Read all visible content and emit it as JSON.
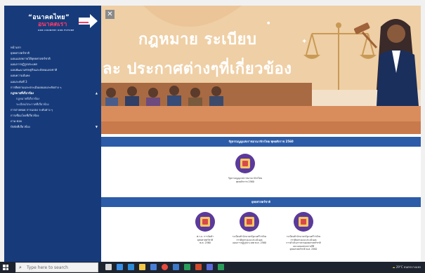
{
  "sidebar": {
    "logo_line1": "“อนาคตไทย”",
    "logo_line2": "อนาคตเรา",
    "logo_tagline": "OUR COUNTRY OUR FUTURE",
    "items": [
      {
        "label": "หน้าแรก",
        "sub": false,
        "caret": ""
      },
      {
        "label": "ยุทธศาสตร์ชาติ",
        "sub": false,
        "caret": ""
      },
      {
        "label": "แผนแม่บทภายใต้ยุทธศาสตร์ชาติ",
        "sub": false,
        "caret": ""
      },
      {
        "label": "แผนการปฏิรูปประเทศ",
        "sub": false,
        "caret": ""
      },
      {
        "label": "แผนพัฒนาเศรษฐกิจและสังคมแห่งชาติ",
        "sub": false,
        "caret": ""
      },
      {
        "label": "แผนความมั่นคง",
        "sub": false,
        "caret": ""
      },
      {
        "label": "แผนระดับที่ 3",
        "sub": false,
        "caret": ""
      },
      {
        "label": "การติดตามและประเมินผลแผนระดับต่าง ๆ",
        "sub": false,
        "caret": ""
      },
      {
        "label": "กฎหมายที่เกี่ยวข้อง",
        "sub": false,
        "caret": "▲"
      },
      {
        "label": "กฎหมายที่เกี่ยวข้อง",
        "sub": true,
        "caret": ""
      },
      {
        "label": "ระเบียบ/ประกาศที่เกี่ยวข้อง",
        "sub": true,
        "caret": ""
      },
      {
        "label": "การถ่ายทอด การแปลง ระดับต่าง ๆ",
        "sub": false,
        "caret": ""
      },
      {
        "label": "การเชื่อมโยงที่เกี่ยวข้อง",
        "sub": false,
        "caret": ""
      },
      {
        "label": "ถาม-ตอบ",
        "sub": false,
        "caret": ""
      },
      {
        "label": "ปัจจัยที่เกี่ยวข้อง",
        "sub": false,
        "caret": "▼"
      }
    ]
  },
  "banner": {
    "close_label": "✕",
    "title_line1": "กฎหมาย ระเบียบ",
    "title_line2": "ละ ประกาศต่างๆที่เกี่ยวข้อง"
  },
  "sections": [
    {
      "header": "รัฐธรรมนูญแห่งราชอาณาจักรไทย พุทธศักราช 2560",
      "cards": [
        {
          "text": "รัฐธรรมนูญแห่งราชอาณาจักรไทย\nพุทธศักราช 2560"
        }
      ]
    },
    {
      "header": "ยุทธศาสตร์ชาติ",
      "cards": [
        {
          "text": "พ.ร.บ. การจัดทำ\nยุทธศาสตร์ชาติ\nพ.ศ. 2560"
        },
        {
          "text": "ระเบียบสำนักนายกรัฐมนตรีว่าด้วย\nการติดตามและประเมินผล\nแผนการปฏิรูปประเทศ พ.ศ. 2560"
        },
        {
          "text": "ระเบียบสำนักนายกรัฐมนตรีว่าด้วย\nการติดตามและประเมินผล\nการดำเนินการตามยุทธศาสตร์ชาติ\nและแผนแม่บทภายใต้\nยุทธศาสตร์ชาติ พ.ศ. 2562"
        }
      ]
    }
  ],
  "taskbar": {
    "search_placeholder": "Type here to search",
    "tray_text": "29°C  ฝนตกบางแห่ง"
  },
  "colors": {
    "sidebar_bg": "#173b7a",
    "section_header_bg": "#2c5ca8",
    "banner_bg": "#efcfa5",
    "icon_purple": "#5b3a9a"
  }
}
